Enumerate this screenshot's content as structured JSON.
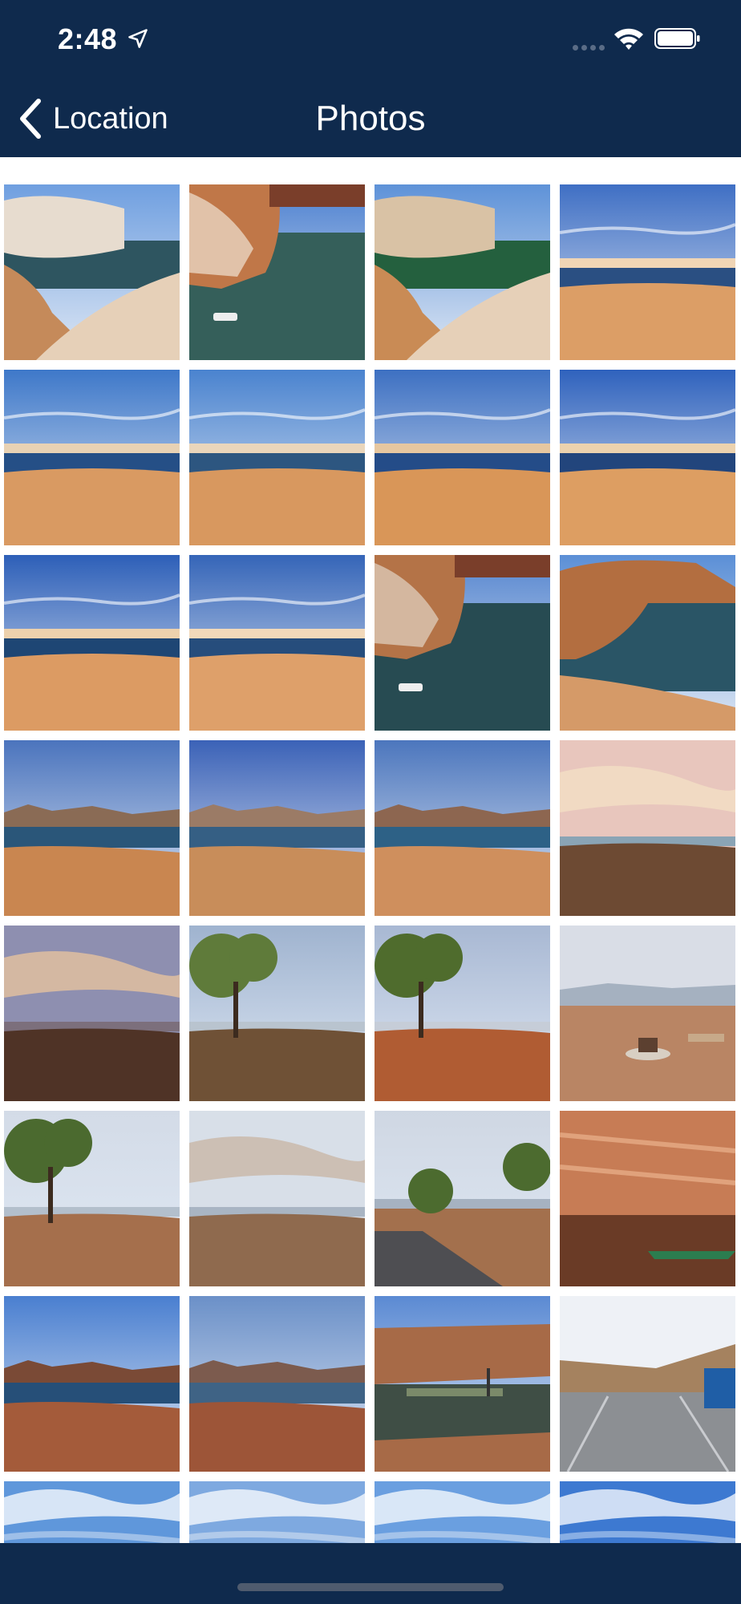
{
  "status_bar": {
    "time": "2:48",
    "location_icon": "location-arrow-icon",
    "signal_icon": "cellular-signal-icon",
    "wifi_icon": "wifi-icon",
    "battery_icon": "battery-icon"
  },
  "nav": {
    "back_label": "Location",
    "back_icon": "chevron-left-icon",
    "title": "Photos"
  },
  "colors": {
    "header_bg": "#0f2a4d",
    "sky": "#4a77c2",
    "water": "#1f4e7a",
    "sand": "#d99a62",
    "rock": "#b56b3d",
    "background": "#ffffff"
  },
  "photos": [
    {
      "scene": "rock-lake",
      "sky": "#6f9fe0",
      "water": "#2e5560",
      "ground": "#c58a5a",
      "accent": "#e7dccf"
    },
    {
      "scene": "cliff-boat",
      "sky": "#4c80d0",
      "water": "#355f5a",
      "ground": "#c07748",
      "accent": "#efe3d3"
    },
    {
      "scene": "rock-lake",
      "sky": "#5e92d8",
      "water": "#24603e",
      "ground": "#c98b55",
      "accent": "#d9c2a5"
    },
    {
      "scene": "desert-lake",
      "sky": "#3f6fc4",
      "water": "#2a4f82",
      "ground": "#dc9e66",
      "accent": "#f0d5b5"
    },
    {
      "scene": "desert-lake",
      "sky": "#3e78c9",
      "water": "#254f86",
      "ground": "#d99a62",
      "accent": "#e8d2b4"
    },
    {
      "scene": "desert-lake",
      "sky": "#4a83cf",
      "water": "#2d5680",
      "ground": "#d8985f",
      "accent": "#ead6bb"
    },
    {
      "scene": "desert-lake",
      "sky": "#3d70c2",
      "water": "#244c88",
      "ground": "#d99658",
      "accent": "#e6c7a0"
    },
    {
      "scene": "desert-lake",
      "sky": "#2f62bd",
      "water": "#22457c",
      "ground": "#dd9e62",
      "accent": "#ecd2ae"
    },
    {
      "scene": "desert-lake",
      "sky": "#2d5fb8",
      "water": "#1e4674",
      "ground": "#dc9b63",
      "accent": "#ecd1ad"
    },
    {
      "scene": "desert-lake",
      "sky": "#3565b8",
      "water": "#264d7c",
      "ground": "#dea06a",
      "accent": "#f2d9ba"
    },
    {
      "scene": "cliff-boat",
      "sky": "#5585cf",
      "water": "#274b52",
      "ground": "#b47347",
      "accent": "#e1d4c4"
    },
    {
      "scene": "cliff-lake",
      "sky": "#5b8fd6",
      "water": "#2a5566",
      "ground": "#d59a68",
      "accent": "#b36e40"
    },
    {
      "scene": "mesa-lake",
      "sky": "#4b74bd",
      "water": "#2a5679",
      "ground": "#c98650",
      "accent": "#8a6b55"
    },
    {
      "scene": "mesa-lake",
      "sky": "#3b62b7",
      "water": "#355f84",
      "ground": "#c88d5a",
      "accent": "#9b7b66"
    },
    {
      "scene": "mesa-lake",
      "sky": "#4c76bd",
      "water": "#2d6186",
      "ground": "#cf8f5d",
      "accent": "#8d6650"
    },
    {
      "scene": "sunset-desert",
      "sky": "#e8c6bd",
      "water": "#8aa4b5",
      "ground": "#6d4a33",
      "accent": "#f3dec4"
    },
    {
      "scene": "sunset-desert",
      "sky": "#8e8fb0",
      "water": "#7c6f7c",
      "ground": "#4f3326",
      "accent": "#e6c29f"
    },
    {
      "scene": "tree-desert",
      "sky": "#9fb3cf",
      "water": "#b9c4cf",
      "ground": "#6f5136",
      "accent": "#5f7b3a"
    },
    {
      "scene": "tree-desert",
      "sky": "#a8b8d3",
      "water": "#c6cdd8",
      "ground": "#b05c33",
      "accent": "#4f6c2d"
    },
    {
      "scene": "campsite",
      "sky": "#d9dde6",
      "water": "#a5b1c0",
      "ground": "#b98564",
      "accent": "#5c4030"
    },
    {
      "scene": "tree-desert",
      "sky": "#d3dbe7",
      "water": "#b3bfcc",
      "ground": "#a56f4c",
      "accent": "#4b6a2f"
    },
    {
      "scene": "sunset-desert",
      "sky": "#d8dfe8",
      "water": "#a9b5c3",
      "ground": "#8f6a4e",
      "accent": "#c9b7a6"
    },
    {
      "scene": "tree-road",
      "sky": "#cfd7e3",
      "water": "#a6b2c1",
      "ground": "#a3704d",
      "accent": "#4c6b2f"
    },
    {
      "scene": "canoe-cliff",
      "sky": "#c9734c",
      "water": "#6a3b26",
      "ground": "#b55c36",
      "accent": "#2b7d4f"
    },
    {
      "scene": "mesa-lake",
      "sky": "#4a7fd0",
      "water": "#264f78",
      "ground": "#a45b3a",
      "accent": "#7a4a36"
    },
    {
      "scene": "mesa-lake",
      "sky": "#6b90c8",
      "water": "#3f6385",
      "ground": "#9d5538",
      "accent": "#7c5b4e"
    },
    {
      "scene": "dock-lake",
      "sky": "#5b8ad3",
      "water": "#3f4e45",
      "ground": "#a76a47",
      "accent": "#7b8a6a"
    },
    {
      "scene": "ramp",
      "sky": "#eef1f6",
      "water": "#a0a4a8",
      "ground": "#8c8f93",
      "accent": "#1f5ea6"
    },
    {
      "scene": "sky-only",
      "sky": "#5f97db",
      "water": "#b9d0ee",
      "ground": "#d6e3f3",
      "accent": "#ffffff"
    },
    {
      "scene": "sky-only",
      "sky": "#7ea9e0",
      "water": "#c7d8ee",
      "ground": "#e1ebf6",
      "accent": "#ffffff"
    },
    {
      "scene": "sky-only",
      "sky": "#6a9fe0",
      "water": "#bed3ee",
      "ground": "#e2ecf8",
      "accent": "#ffffff"
    },
    {
      "scene": "sky-only",
      "sky": "#3d79d1",
      "water": "#a8c5ec",
      "ground": "#dbe7f6",
      "accent": "#ffffff"
    }
  ]
}
